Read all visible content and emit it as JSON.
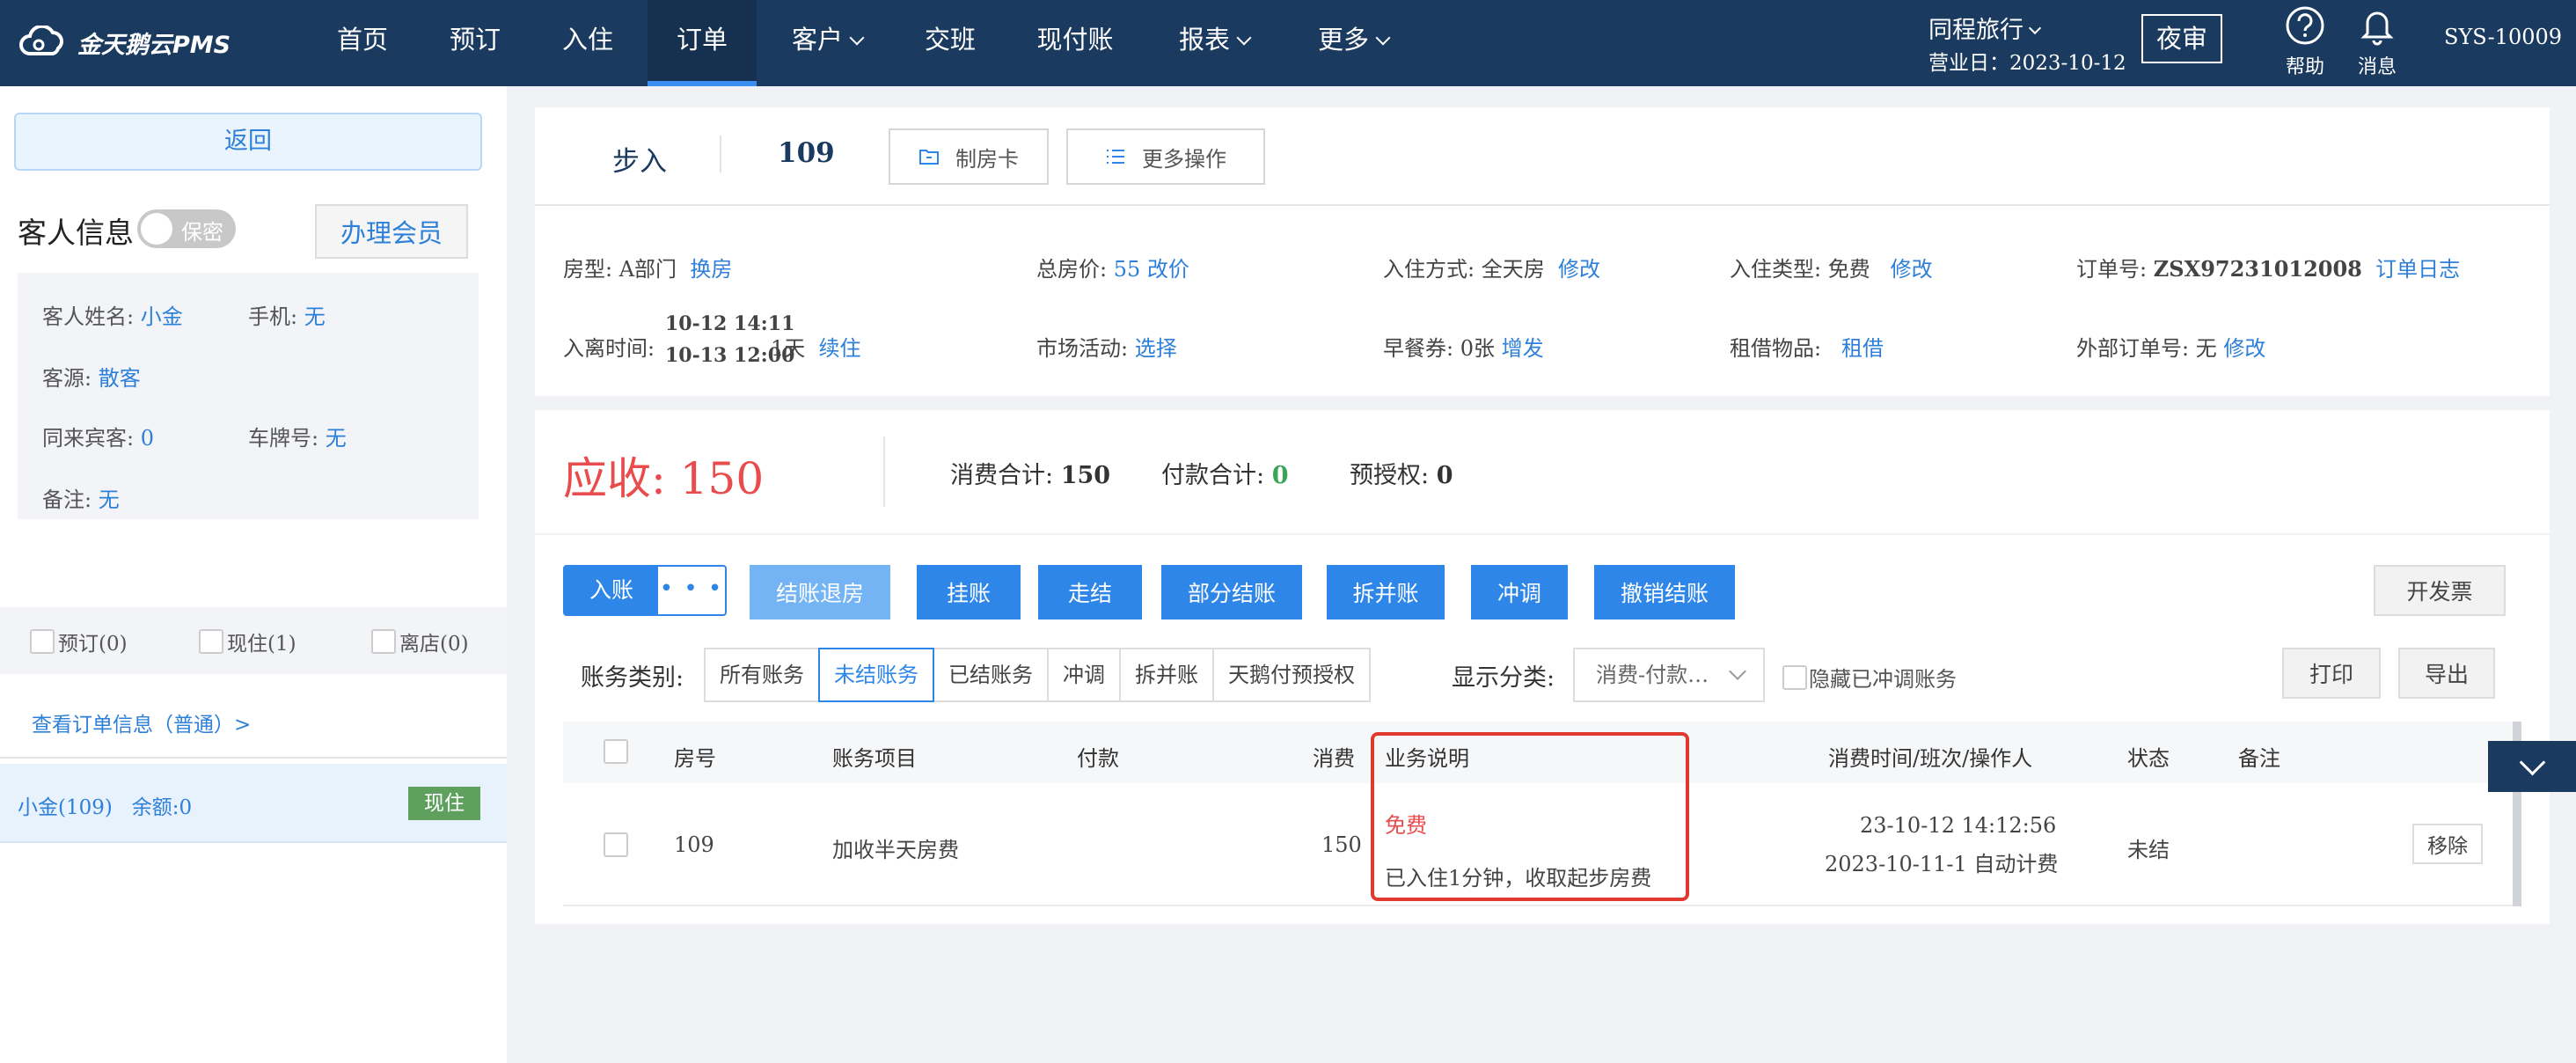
{
  "app": {
    "logo_text": "金天鹅云PMS"
  },
  "nav": [
    {
      "label": "首页"
    },
    {
      "label": "预订"
    },
    {
      "label": "入住"
    },
    {
      "label": "订单",
      "active": true
    },
    {
      "label": "客户"
    },
    {
      "label": "交班"
    },
    {
      "label": "现付账"
    },
    {
      "label": "报表"
    },
    {
      "label": "更多"
    }
  ],
  "header": {
    "hotel": "同程旅行",
    "business_day": "营业日：2023-10-12",
    "night_audit": "夜审",
    "help": "帮助",
    "messages": "消息",
    "user": "SYS-10009"
  },
  "sidebar": {
    "back": "返回",
    "guest_info_title": "客人信息",
    "privacy_toggle": "保密",
    "member_button": "办理会员",
    "guest": {
      "name_label": "客人姓名: ",
      "name": "小金",
      "phone_label": "手机: ",
      "phone": "无",
      "source_label": "客源: ",
      "source": "散客",
      "companions_label": "同来宾客: ",
      "companions": "0",
      "plate_label": "车牌号: ",
      "plate": "无",
      "remark_label": "备注: ",
      "remark": "无"
    },
    "status_filters": [
      "预订(0)",
      "现住(1)",
      "离店(0)"
    ],
    "view_order": "查看订单信息（普通）>",
    "guest_row": {
      "name": "小金(109)",
      "balance": "余额:0",
      "badge": "现住"
    }
  },
  "order": {
    "step_label": "步入",
    "room_no": "109",
    "make_card": "制房卡",
    "more_ops": "更多操作",
    "room_type_label": "房型: ",
    "room_type": "A部门",
    "change_room": "换房",
    "total_price_label": "总房价: ",
    "total_price": "55",
    "change_price": "改价",
    "checkin_mode_label": "入住方式: ",
    "checkin_mode": "全天房",
    "modify": "修改",
    "checkin_type_label": "入住类型: ",
    "checkin_type": "免费",
    "order_no_label": "订单号: ",
    "order_no": "ZSX97231012008",
    "order_log": "订单日志",
    "stay_label": "入离时间: ",
    "arrive": "10-12 14:11",
    "depart": "10-13 12:00",
    "nights": "1天",
    "extend": "续住",
    "market_label": "市场活动: ",
    "market": "选择",
    "breakfast_label": "早餐券: ",
    "breakfast": "0张",
    "add_breakfast": "增发",
    "rental_label": "租借物品: ",
    "rental": "租借",
    "ext_order_label": "外部订单号: ",
    "ext_order": "无"
  },
  "summary": {
    "receivable_label": "应收: ",
    "receivable": "150",
    "consume_label": "消费合计: ",
    "consume": "150",
    "pay_label": "付款合计: ",
    "pay": "0",
    "preauth_label": "预授权: ",
    "preauth": "0"
  },
  "actions": {
    "post": "入账",
    "post_more": "• • •",
    "checkout": "结账退房",
    "hang": "挂账",
    "walk": "走结",
    "partial": "部分结账",
    "split_merge": "拆并账",
    "adjust": "冲调",
    "cancel_checkout": "撤销结账",
    "invoice": "开发票",
    "print": "打印",
    "export": "导出"
  },
  "filters": {
    "category_label": "账务类别: ",
    "tabs": [
      "所有账务",
      "未结账务",
      "已结账务",
      "冲调",
      "拆并账",
      "天鹅付预授权"
    ],
    "active_tab": "未结账务",
    "display_label": "显示分类: ",
    "display_value": "消费-付款…",
    "hide_adjusted": "隐藏已冲调账务"
  },
  "table": {
    "headers": [
      "房号",
      "账务项目",
      "付款",
      "消费",
      "业务说明",
      "消费时间/班次/操作人",
      "状态",
      "备注"
    ],
    "rows": [
      {
        "room": "109",
        "item": "加收半天房费",
        "payment": "",
        "consume": "150",
        "desc_tag": "免费",
        "desc": "已入住1分钟，收取起步房费",
        "time": "23-10-12 14:12:56",
        "shift": "2023-10-11-1 自动计费",
        "status": "未结",
        "remark": "",
        "remove": "移除"
      }
    ]
  },
  "colors": {
    "nav_bg": "#1b3a5f",
    "primary": "#2e86e8",
    "danger": "#e84c4c",
    "success": "#3aa655",
    "highlight": "#e03a2f"
  }
}
